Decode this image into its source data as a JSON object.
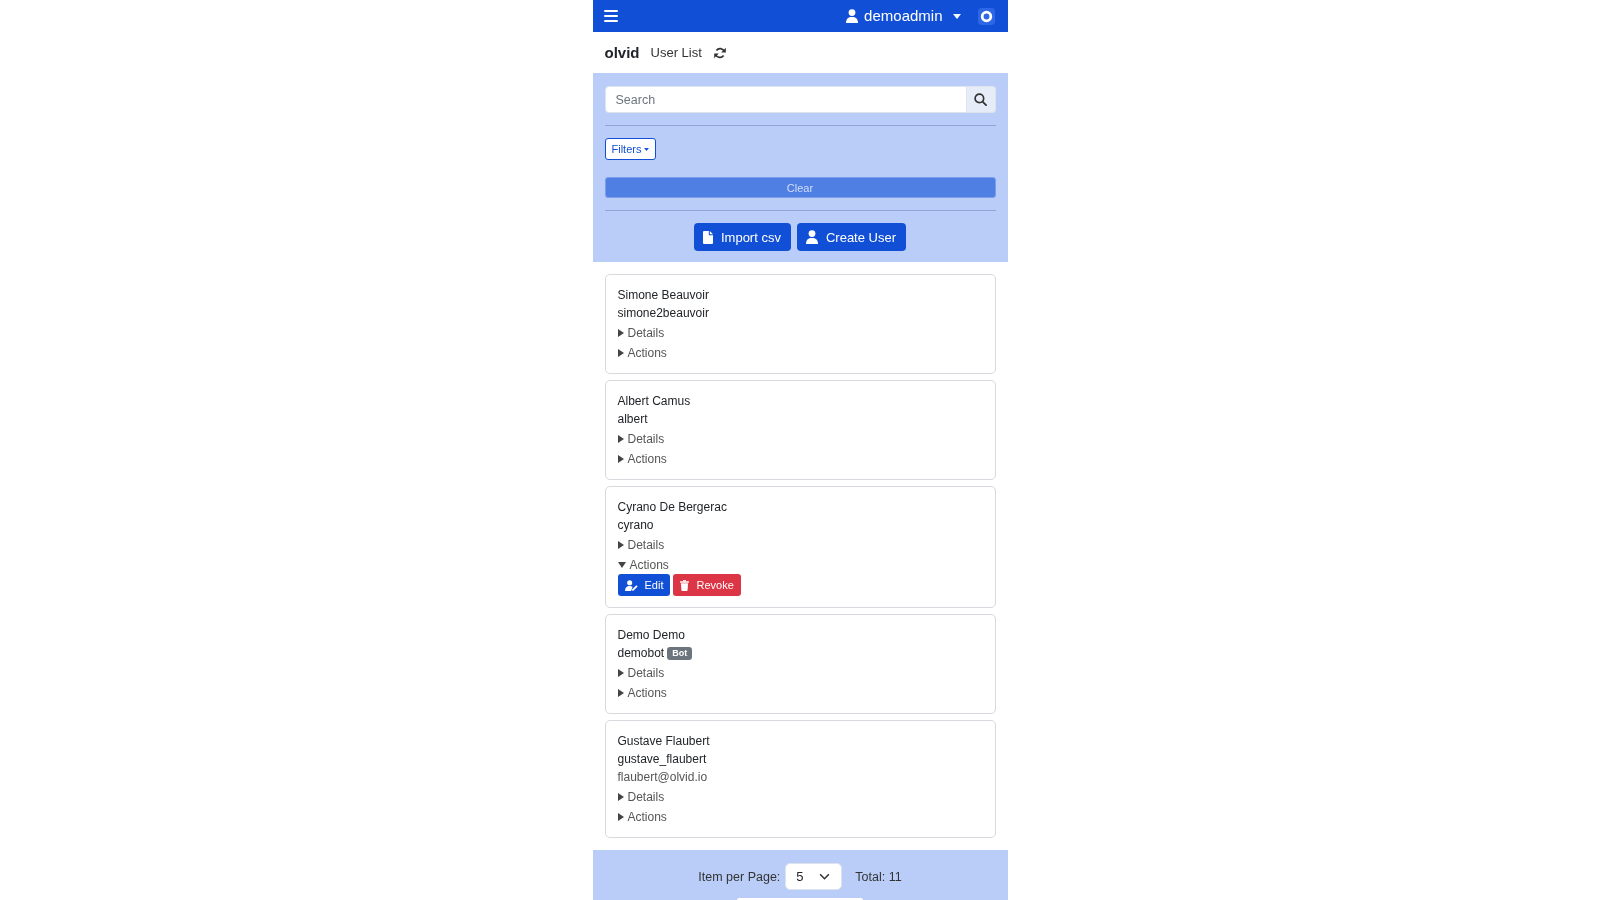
{
  "navbar": {
    "user": "demoadmin"
  },
  "header": {
    "brand": "olvid",
    "title": "User List"
  },
  "filters": {
    "search": {
      "placeholder": "Search"
    },
    "filters_button": "Filters",
    "clear_button": "Clear",
    "buttons": [
      "Import csv",
      "Create User"
    ]
  },
  "users": [
    {
      "name": "Simone Beauvoir",
      "username": "simone2beauvoir",
      "sections": [
        {
          "label": "Details",
          "expanded": false
        },
        {
          "label": "Actions",
          "expanded": false
        }
      ]
    },
    {
      "name": "Albert Camus",
      "username": "albert",
      "sections": [
        {
          "label": "Details",
          "expanded": false
        },
        {
          "label": "Actions",
          "expanded": false
        }
      ]
    },
    {
      "name": "Cyrano De Bergerac",
      "username": "cyrano",
      "sections": [
        {
          "label": "Details",
          "expanded": false
        },
        {
          "label": "Actions",
          "expanded": true,
          "buttons": [
            {
              "label": "Edit",
              "kind": "edit"
            },
            {
              "label": "Revoke",
              "kind": "revoke"
            }
          ]
        }
      ]
    },
    {
      "name": "Demo Demo",
      "username": "demobot",
      "badge": "Bot",
      "sections": [
        {
          "label": "Details",
          "expanded": false
        },
        {
          "label": "Actions",
          "expanded": false
        }
      ]
    },
    {
      "name": "Gustave Flaubert",
      "username": "gustave_flaubert",
      "email": "flaubert@olvid.io",
      "sections": [
        {
          "label": "Details",
          "expanded": false
        },
        {
          "label": "Actions",
          "expanded": false
        }
      ]
    }
  ],
  "footer": {
    "per_page_label": "Item per Page:",
    "per_page": "5",
    "total": "Total: 11"
  }
}
